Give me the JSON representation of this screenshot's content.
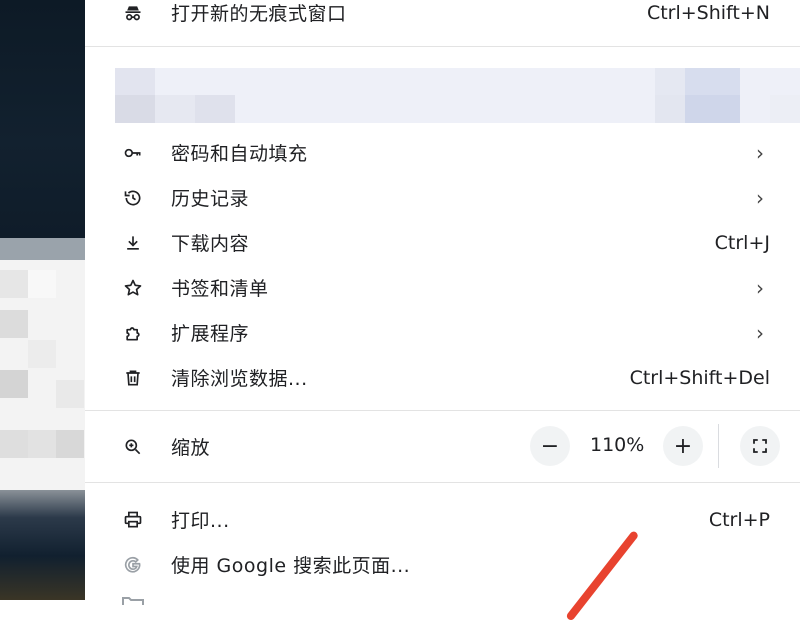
{
  "menu": {
    "incognito": {
      "label": "打开新的无痕式窗口",
      "shortcut": "Ctrl+Shift+N"
    },
    "passwords": {
      "label": "密码和自动填充"
    },
    "history": {
      "label": "历史记录"
    },
    "downloads": {
      "label": "下载内容",
      "shortcut": "Ctrl+J"
    },
    "bookmarks": {
      "label": "书签和清单"
    },
    "extensions": {
      "label": "扩展程序"
    },
    "clear_data": {
      "label": "清除浏览数据...",
      "shortcut": "Ctrl+Shift+Del"
    },
    "zoom": {
      "label": "缩放",
      "value": "110%",
      "minus": "−",
      "plus": "+"
    },
    "print": {
      "label": "打印...",
      "shortcut": "Ctrl+P"
    },
    "google_search": {
      "label": "使用 Google 搜索此页面..."
    }
  },
  "colors": {
    "accent_arrow": "#e8432f",
    "menu_bg": "#ffffff",
    "separator": "#e3e3e3"
  }
}
